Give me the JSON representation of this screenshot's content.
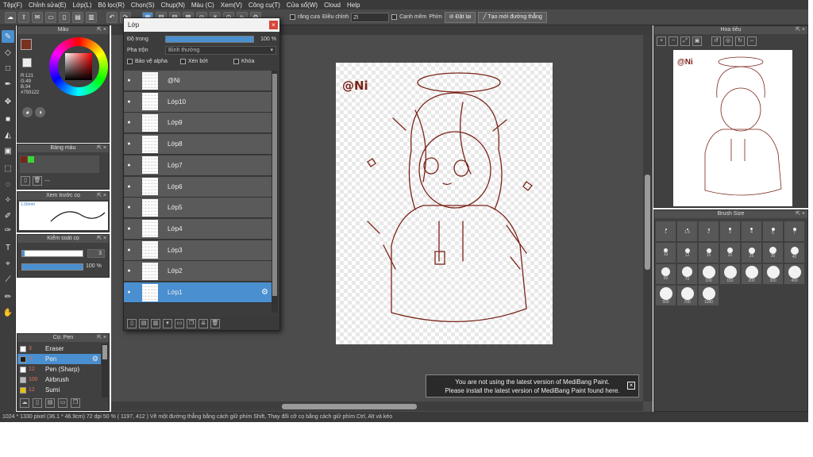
{
  "menu": [
    "Tệp(F)",
    "Chỉnh sửa(E)",
    "Lớp(L)",
    "Bộ lọc(R)",
    "Chọn(S)",
    "Chụp(N)",
    "Màu (C)",
    "Xem(V)",
    "Công cụ(T)",
    "Cửa sổ(W)",
    "Cloud",
    "Help"
  ],
  "toolbar": {
    "antialias": "răng cưa",
    "adjust_label": "Điều chỉnh",
    "adjust_value": "Zł",
    "edge": "Cạnh mềm",
    "key_label": "Phím",
    "reset_btn": "Đặt lại",
    "line_btn": "Tạo mới đường thẳng"
  },
  "color_panel": {
    "title": "Màu",
    "r": "R:121",
    "g": "G:49",
    "b": "B:34",
    "hex": "#793122",
    "main_color": "#793122"
  },
  "palette_panel": {
    "title": "Bảng màu",
    "more": "---"
  },
  "preview_panel": {
    "title": "Xem trước cọ",
    "size": "1.06mm"
  },
  "control_panel": {
    "title": "Kiểm soát cọ",
    "size_value": "3",
    "opacity_value": "100 %"
  },
  "brush_panel": {
    "title": "Cọ: Pen",
    "items": [
      {
        "size": "3",
        "name": "Eraser",
        "color": "#ffffff"
      },
      {
        "size": "3",
        "name": "Pen",
        "color": "#1a1a1a"
      },
      {
        "size": "12",
        "name": "Pen (Sharp)",
        "color": "#ffffff"
      },
      {
        "size": "100",
        "name": "Airbrush",
        "color": "#bbbbbb"
      },
      {
        "size": "12",
        "name": "Sumi",
        "color": "#e8c300"
      }
    ]
  },
  "layer_window": {
    "title": "Lớp",
    "close": "×",
    "opacity_label": "Độ trong",
    "opacity_value": "100 %",
    "blend_label": "Pha trộn",
    "blend_value": "Bình thường",
    "protect_alpha": "Bảo vệ alpha",
    "clipping": "Xén bớt",
    "lock": "Khóa",
    "layers": [
      "@Ni",
      "Lớp10",
      "Lớp9",
      "Lớp8",
      "Lớp7",
      "Lớp6",
      "Lớp5",
      "Lớp4",
      "Lớp3",
      "Lớp2",
      "Lớp1"
    ],
    "selected_layer": "Lớp1"
  },
  "canvas": {
    "signature": "@Ni"
  },
  "navigator": {
    "title": "Hoa tiêu",
    "signature": "@Ni"
  },
  "brush_size": {
    "title": "Brush Size",
    "sizes": [
      "1",
      "1.5",
      "2",
      "3",
      "4",
      "5",
      "7",
      "10",
      "12",
      "15",
      "20",
      "25",
      "30",
      "40",
      "50",
      "70",
      "100",
      "150",
      "200",
      "300",
      "400",
      "500",
      "700",
      "1000"
    ]
  },
  "notification": {
    "line1": "You are not using the latest version of MediBang Paint.",
    "line2": "Please install the latest version of MediBang Paint found here."
  },
  "status": "1024 * 1330 pixel   (36.1 * 46.9cm)   72 dpi   50 %   ( 1197, 412 )   Vẽ một đường thẳng bằng cách giữ phím Shift, Thay đổi cỡ cọ bằng cách giữ phím Ctrl, Alt và kéo"
}
